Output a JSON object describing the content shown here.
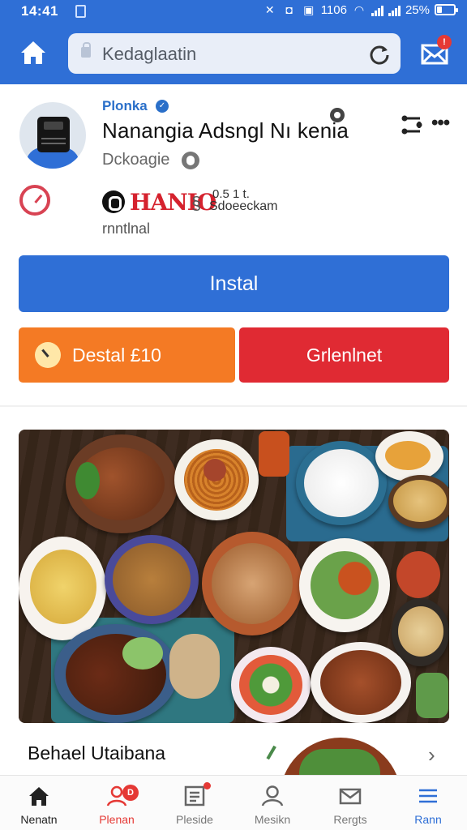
{
  "status": {
    "time": "14:41",
    "battery": "25%",
    "network": "1106"
  },
  "browser": {
    "url": "Kedaglaatin",
    "mail_badge": "!"
  },
  "app": {
    "developer": "Plonka",
    "title": "Nanangia Adsngl Nı kenia",
    "category": "Dckoagie",
    "brand_text": "HANIO",
    "stat_count": "0.5 1 t.",
    "stat_label": "Sdoeeckam",
    "sub_label": "rnntlnal"
  },
  "actions": {
    "install_label": "Instal",
    "orange_label": "Destal £10",
    "red_label": "Grlenlnet"
  },
  "section": {
    "title": "Behael Utaibana"
  },
  "nav": {
    "items": [
      {
        "label": "Nenatn",
        "color": "#222222"
      },
      {
        "label": "Plenan",
        "color": "#e53935",
        "badge": "D"
      },
      {
        "label": "Pleside",
        "color": "#777777"
      },
      {
        "label": "Mesikn",
        "color": "#777777"
      },
      {
        "label": "Rergts",
        "color": "#777777"
      },
      {
        "label": "Rann",
        "color": "#2f6fd6"
      }
    ]
  },
  "colors": {
    "accent": "#2f6fd6",
    "orange": "#f47a24",
    "red": "#e02a33"
  }
}
